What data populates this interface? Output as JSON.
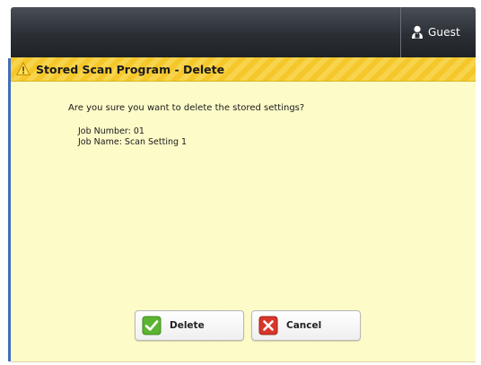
{
  "topbar": {
    "user_icon": "user-icon",
    "user_label": "Guest"
  },
  "dialog": {
    "warning_icon": "warning-icon",
    "title": "Stored Scan Program - Delete",
    "question": "Are you sure you want to delete the stored settings?",
    "job_number_line": "Job Number: 01",
    "job_name_line": "Job Name: Scan Setting 1"
  },
  "buttons": {
    "delete_label": "Delete",
    "delete_icon": "checkmark-icon",
    "cancel_label": "Cancel",
    "cancel_icon": "x-icon"
  },
  "colors": {
    "header_yellow": "#f5c72a",
    "body_yellow": "#fdfbc8",
    "topbar_dark": "#2b2f35",
    "accent_blue": "#3f6fbf",
    "delete_green": "#5cb531",
    "cancel_red": "#d9362b"
  }
}
